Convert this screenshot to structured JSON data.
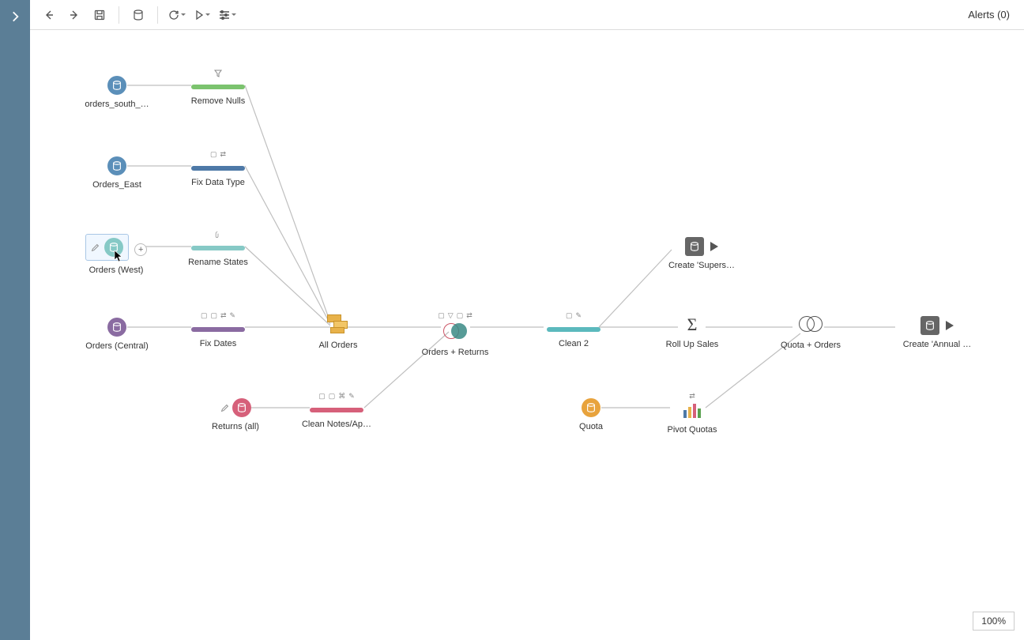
{
  "alerts_label": "Alerts (0)",
  "zoom_label": "100%",
  "nodes": {
    "orders_south": "orders_south_…",
    "remove_nulls": "Remove Nulls",
    "orders_east": "Orders_East",
    "fix_data_type": "Fix Data Type",
    "orders_west": "Orders (West)",
    "rename_states": "Rename States",
    "orders_central": "Orders (Central)",
    "fix_dates": "Fix Dates",
    "all_orders": "All Orders",
    "orders_returns": "Orders + Returns",
    "clean2": "Clean 2",
    "rollup_sales": "Roll Up Sales",
    "quota_orders": "Quota + Orders",
    "create_annual": "Create 'Annual …",
    "create_supers": "Create 'Supers…",
    "returns_all": "Returns (all)",
    "clean_notes": "Clean Notes/Ap…",
    "quota": "Quota",
    "pivot_quotas": "Pivot Quotas"
  },
  "colors": {
    "input_blue": "#5b8fb9",
    "input_purple": "#8a6ba1",
    "input_teal": "#86c9c6",
    "input_pink": "#d6607a",
    "input_orange": "#e8a33d"
  }
}
